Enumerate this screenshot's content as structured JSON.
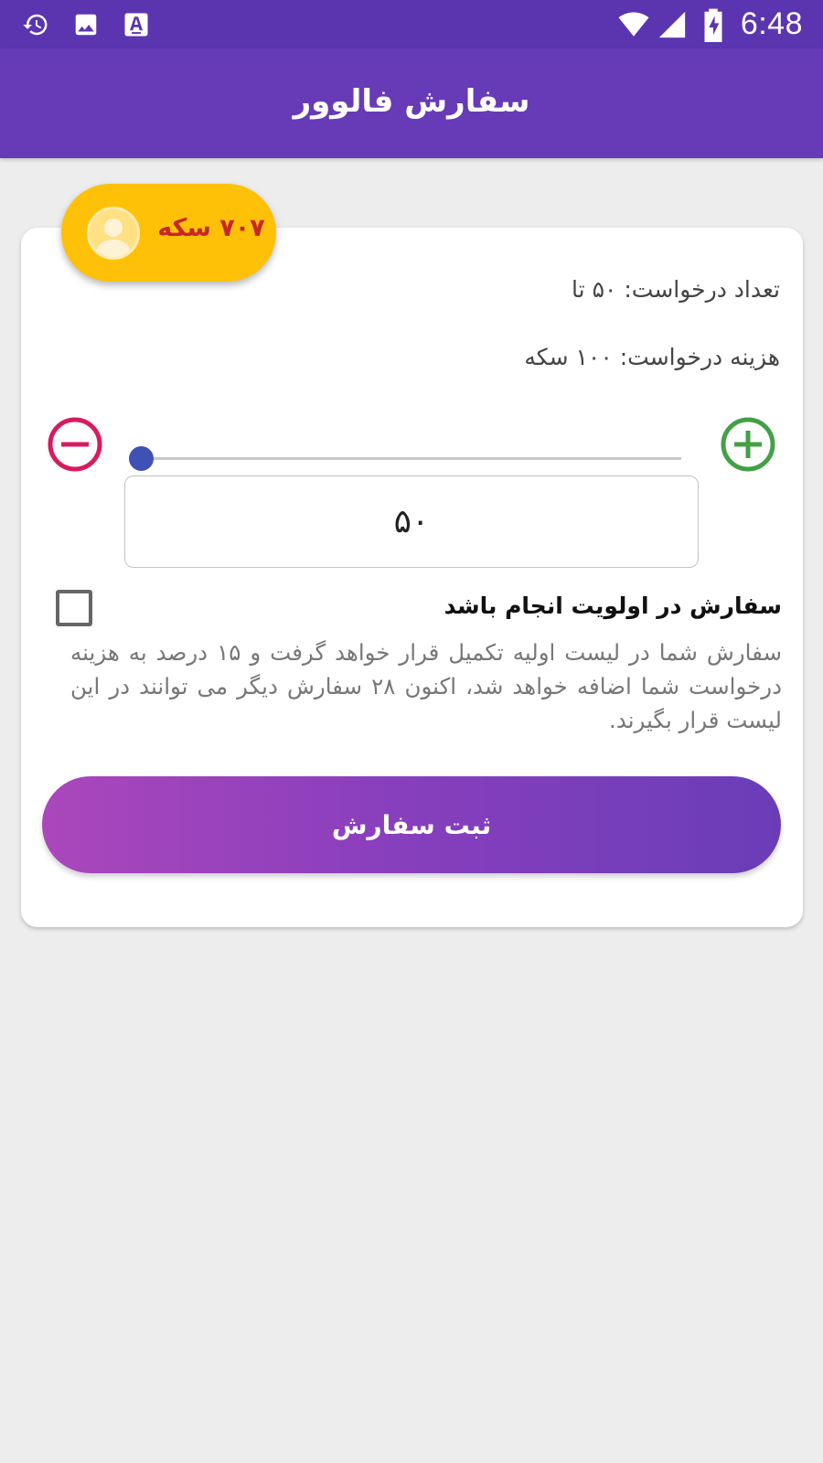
{
  "status_bar": {
    "time": "6:48",
    "icons": [
      "history-icon",
      "image-icon",
      "keyboard-a-icon",
      "wifi-icon",
      "signal-icon",
      "battery-charging-icon"
    ]
  },
  "app_bar": {
    "title": "سفارش فالوور"
  },
  "coin_badge": {
    "text": "۷۰۷ سکه",
    "icon": "user-avatar-icon"
  },
  "order": {
    "request_count": "تعداد درخواست: ۵۰ تا",
    "request_cost": "هزینه درخواست: ۱۰۰ سکه",
    "quantity_value": "۵۰",
    "slider_level": 0
  },
  "priority": {
    "label": "سفارش در اولویت انجام باشد",
    "checked": false,
    "description": "سفارش شما در لیست اولیه تکمیل قرار خواهد گرفت و ۱۵ درصد به هزینه درخواست شما اضافه خواهد شد، اکنون ۲۸ سفارش دیگر می توانند در این لیست قرار بگیرند."
  },
  "submit": {
    "label": "ثبت سفارش"
  },
  "colors": {
    "status_bar": "#5b35b0",
    "app_bar": "#673ab7",
    "coin_badge": "#ffc107",
    "coin_text": "#c62828",
    "minus": "#d81b60",
    "plus": "#43a047",
    "slider_thumb": "#3f51b5"
  }
}
